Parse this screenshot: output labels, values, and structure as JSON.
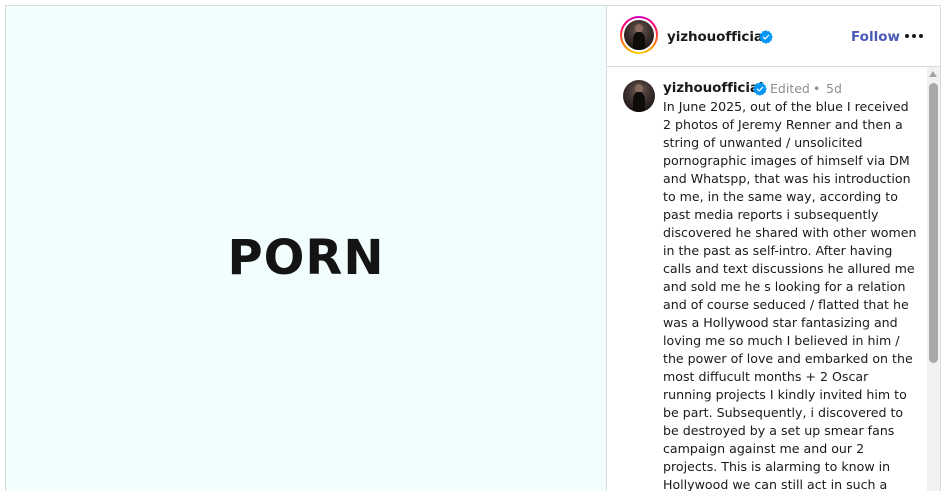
{
  "media": {
    "overlay_word": "PORN",
    "background_color": "#f2fefe"
  },
  "header": {
    "username": "yizhouofficial",
    "verified_icon": "verified-badge-icon",
    "follow_label": "Follow",
    "more_icon": "more-options-icon",
    "follow_color": "#4a58b8"
  },
  "caption": {
    "username": "yizhouofficial",
    "edited_label": "Edited",
    "separator": "•",
    "time_ago": "5d",
    "lines": [
      "In June 2025, out of the blue I received",
      "2 photos of Jeremy Renner and then a",
      "string of unwanted / unsolicited",
      "pornographic images of himself via DM",
      "and Whatspp, that was his introduction",
      "to me, in the same way, according to",
      "past media reports i subsequently",
      "discovered he shared with other women",
      "in the past as self-intro. After having",
      "calls and text discussions he allured me",
      "and sold me he s looking for a relation",
      "and of course seduced / flatted that he",
      "was a Hollywood star fantasizing and",
      "loving me so much I believed in him /",
      "the power of love and embarked on the",
      "most diffucult months + 2 Oscar",
      "running projects I kindly invited him to",
      "be part. Subsequently, i discovered to",
      "be destroyed by a set up smear fans",
      "campaign against me and our 2",
      "projects. This is alarming to know in",
      "Hollywood we can still act in such a"
    ]
  },
  "colors": {
    "verified_blue": "#0095f6",
    "text": "#1a1a1a",
    "muted": "#8e8e8e",
    "border": "#dbdbdb"
  }
}
